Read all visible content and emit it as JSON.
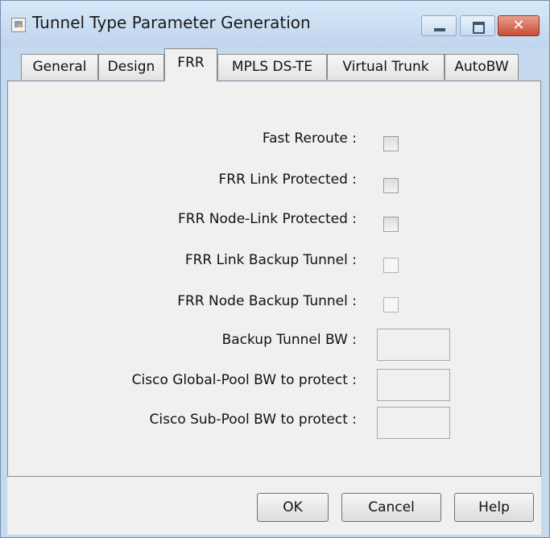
{
  "window": {
    "title": "Tunnel Type Parameter Generation",
    "close_glyph": "✕"
  },
  "tabs": [
    {
      "label": "General"
    },
    {
      "label": "Design"
    },
    {
      "label": "FRR",
      "active": true
    },
    {
      "label": "MPLS DS-TE"
    },
    {
      "label": "Virtual Trunk"
    },
    {
      "label": "AutoBW"
    }
  ],
  "form": {
    "fast_reroute": {
      "label": "Fast Reroute :",
      "checked": false
    },
    "frr_link_protected": {
      "label": "FRR Link Protected :",
      "checked": false
    },
    "frr_node_link_protected": {
      "label": "FRR Node-Link Protected :",
      "checked": false
    },
    "frr_link_backup_tunnel": {
      "label": "FRR Link Backup Tunnel :",
      "checked": false
    },
    "frr_node_backup_tunnel": {
      "label": "FRR Node Backup Tunnel :",
      "checked": false
    },
    "backup_tunnel_bw": {
      "label": "Backup Tunnel BW :",
      "value": ""
    },
    "global_pool_bw": {
      "label": "Cisco Global-Pool BW to protect :",
      "value": ""
    },
    "sub_pool_bw": {
      "label": "Cisco Sub-Pool BW to protect :",
      "value": ""
    }
  },
  "buttons": {
    "ok": "OK",
    "cancel": "Cancel",
    "help": "Help"
  },
  "icons": {
    "app": "java-app-icon",
    "minimize": "minimize-icon",
    "maximize": "maximize-icon",
    "close": "close-icon"
  }
}
